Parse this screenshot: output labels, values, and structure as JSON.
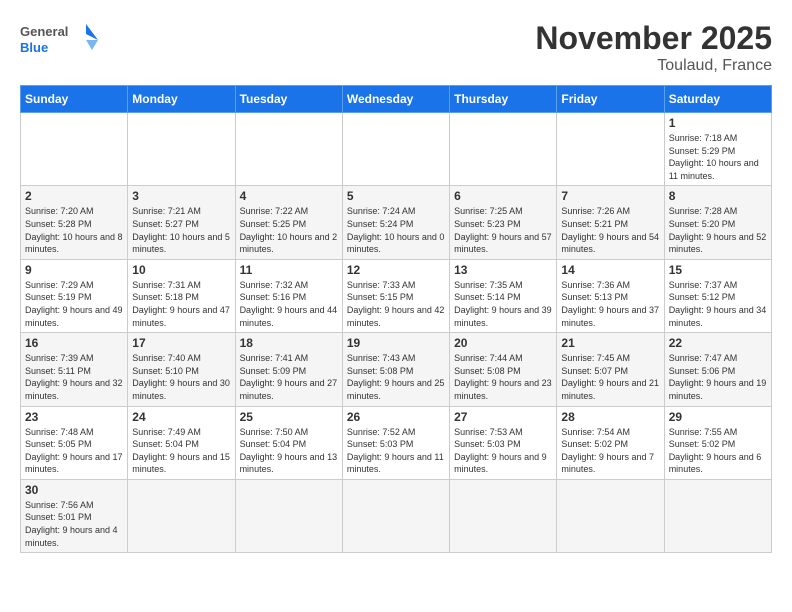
{
  "header": {
    "logo_general": "General",
    "logo_blue": "Blue",
    "month": "November 2025",
    "location": "Toulaud, France"
  },
  "days_of_week": [
    "Sunday",
    "Monday",
    "Tuesday",
    "Wednesday",
    "Thursday",
    "Friday",
    "Saturday"
  ],
  "weeks": [
    [
      {
        "day": "",
        "info": ""
      },
      {
        "day": "",
        "info": ""
      },
      {
        "day": "",
        "info": ""
      },
      {
        "day": "",
        "info": ""
      },
      {
        "day": "",
        "info": ""
      },
      {
        "day": "",
        "info": ""
      },
      {
        "day": "1",
        "info": "Sunrise: 7:18 AM\nSunset: 5:29 PM\nDaylight: 10 hours and 11 minutes."
      }
    ],
    [
      {
        "day": "2",
        "info": "Sunrise: 7:20 AM\nSunset: 5:28 PM\nDaylight: 10 hours and 8 minutes."
      },
      {
        "day": "3",
        "info": "Sunrise: 7:21 AM\nSunset: 5:27 PM\nDaylight: 10 hours and 5 minutes."
      },
      {
        "day": "4",
        "info": "Sunrise: 7:22 AM\nSunset: 5:25 PM\nDaylight: 10 hours and 2 minutes."
      },
      {
        "day": "5",
        "info": "Sunrise: 7:24 AM\nSunset: 5:24 PM\nDaylight: 10 hours and 0 minutes."
      },
      {
        "day": "6",
        "info": "Sunrise: 7:25 AM\nSunset: 5:23 PM\nDaylight: 9 hours and 57 minutes."
      },
      {
        "day": "7",
        "info": "Sunrise: 7:26 AM\nSunset: 5:21 PM\nDaylight: 9 hours and 54 minutes."
      },
      {
        "day": "8",
        "info": "Sunrise: 7:28 AM\nSunset: 5:20 PM\nDaylight: 9 hours and 52 minutes."
      }
    ],
    [
      {
        "day": "9",
        "info": "Sunrise: 7:29 AM\nSunset: 5:19 PM\nDaylight: 9 hours and 49 minutes."
      },
      {
        "day": "10",
        "info": "Sunrise: 7:31 AM\nSunset: 5:18 PM\nDaylight: 9 hours and 47 minutes."
      },
      {
        "day": "11",
        "info": "Sunrise: 7:32 AM\nSunset: 5:16 PM\nDaylight: 9 hours and 44 minutes."
      },
      {
        "day": "12",
        "info": "Sunrise: 7:33 AM\nSunset: 5:15 PM\nDaylight: 9 hours and 42 minutes."
      },
      {
        "day": "13",
        "info": "Sunrise: 7:35 AM\nSunset: 5:14 PM\nDaylight: 9 hours and 39 minutes."
      },
      {
        "day": "14",
        "info": "Sunrise: 7:36 AM\nSunset: 5:13 PM\nDaylight: 9 hours and 37 minutes."
      },
      {
        "day": "15",
        "info": "Sunrise: 7:37 AM\nSunset: 5:12 PM\nDaylight: 9 hours and 34 minutes."
      }
    ],
    [
      {
        "day": "16",
        "info": "Sunrise: 7:39 AM\nSunset: 5:11 PM\nDaylight: 9 hours and 32 minutes."
      },
      {
        "day": "17",
        "info": "Sunrise: 7:40 AM\nSunset: 5:10 PM\nDaylight: 9 hours and 30 minutes."
      },
      {
        "day": "18",
        "info": "Sunrise: 7:41 AM\nSunset: 5:09 PM\nDaylight: 9 hours and 27 minutes."
      },
      {
        "day": "19",
        "info": "Sunrise: 7:43 AM\nSunset: 5:08 PM\nDaylight: 9 hours and 25 minutes."
      },
      {
        "day": "20",
        "info": "Sunrise: 7:44 AM\nSunset: 5:08 PM\nDaylight: 9 hours and 23 minutes."
      },
      {
        "day": "21",
        "info": "Sunrise: 7:45 AM\nSunset: 5:07 PM\nDaylight: 9 hours and 21 minutes."
      },
      {
        "day": "22",
        "info": "Sunrise: 7:47 AM\nSunset: 5:06 PM\nDaylight: 9 hours and 19 minutes."
      }
    ],
    [
      {
        "day": "23",
        "info": "Sunrise: 7:48 AM\nSunset: 5:05 PM\nDaylight: 9 hours and 17 minutes."
      },
      {
        "day": "24",
        "info": "Sunrise: 7:49 AM\nSunset: 5:04 PM\nDaylight: 9 hours and 15 minutes."
      },
      {
        "day": "25",
        "info": "Sunrise: 7:50 AM\nSunset: 5:04 PM\nDaylight: 9 hours and 13 minutes."
      },
      {
        "day": "26",
        "info": "Sunrise: 7:52 AM\nSunset: 5:03 PM\nDaylight: 9 hours and 11 minutes."
      },
      {
        "day": "27",
        "info": "Sunrise: 7:53 AM\nSunset: 5:03 PM\nDaylight: 9 hours and 9 minutes."
      },
      {
        "day": "28",
        "info": "Sunrise: 7:54 AM\nSunset: 5:02 PM\nDaylight: 9 hours and 7 minutes."
      },
      {
        "day": "29",
        "info": "Sunrise: 7:55 AM\nSunset: 5:02 PM\nDaylight: 9 hours and 6 minutes."
      }
    ],
    [
      {
        "day": "30",
        "info": "Sunrise: 7:56 AM\nSunset: 5:01 PM\nDaylight: 9 hours and 4 minutes."
      },
      {
        "day": "",
        "info": ""
      },
      {
        "day": "",
        "info": ""
      },
      {
        "day": "",
        "info": ""
      },
      {
        "day": "",
        "info": ""
      },
      {
        "day": "",
        "info": ""
      },
      {
        "day": "",
        "info": ""
      }
    ]
  ]
}
